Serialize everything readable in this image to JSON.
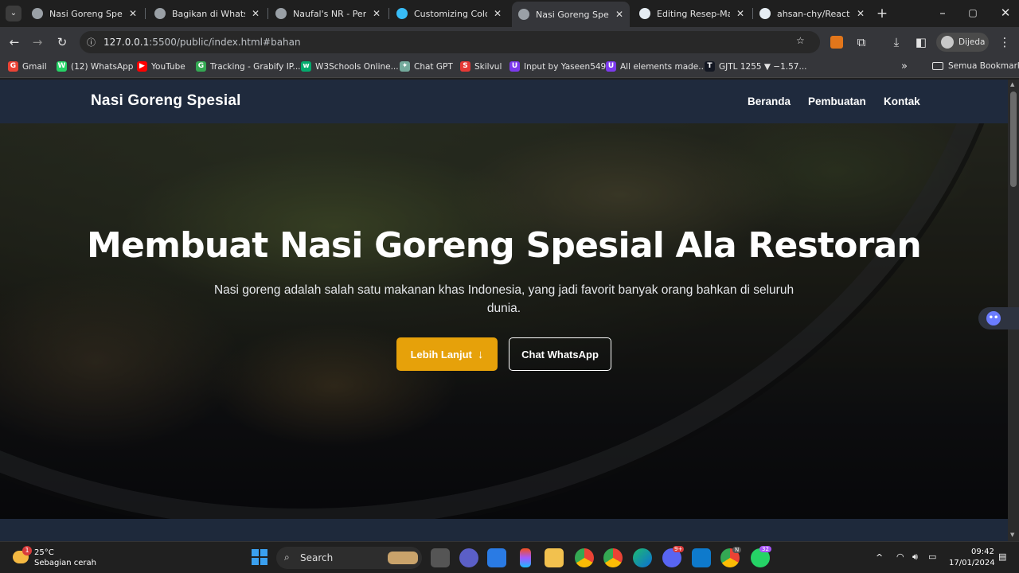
{
  "browser": {
    "tabs": [
      {
        "title": "Nasi Goreng Spesial",
        "active": false,
        "color": "#9aa0a6"
      },
      {
        "title": "Bagikan di WhatsApp",
        "active": false,
        "color": "#9aa0a6"
      },
      {
        "title": "Naufal's NR - Personal",
        "active": false,
        "color": "#9aa0a6"
      },
      {
        "title": "Customizing Colors",
        "active": false,
        "color": "#38bdf8"
      },
      {
        "title": "Nasi Goreng Spesial",
        "active": true,
        "color": "#9aa0a6"
      },
      {
        "title": "Editing Resep-Makan",
        "active": false,
        "color": "#e6edf3"
      },
      {
        "title": "ahsan-chy/React-JS",
        "active": false,
        "color": "#e6edf3"
      }
    ],
    "new_tab": "+",
    "url": {
      "host": "127.0.0.1",
      "rest": ":5500/public/index.html#bahan"
    },
    "profile_label": "Dijeda",
    "bookmarks": [
      {
        "label": "Gmail",
        "icon": "G",
        "color": "#ea4335"
      },
      {
        "label": "(12) WhatsApp",
        "icon": "W",
        "color": "#25d366"
      },
      {
        "label": "YouTube",
        "icon": "▶",
        "color": "#ff0000"
      },
      {
        "label": "Tracking - Grabify IP...",
        "icon": "G",
        "color": "#34a853"
      },
      {
        "label": "W3Schools Online...",
        "icon": "w",
        "color": "#04aa6d"
      },
      {
        "label": "Chat GPT",
        "icon": "✦",
        "color": "#74aa9c"
      },
      {
        "label": "Skilvul",
        "icon": "S",
        "color": "#e53935"
      },
      {
        "label": "Input by Yaseen549",
        "icon": "U",
        "color": "#7c3aed"
      },
      {
        "label": "All elements made...",
        "icon": "U",
        "color": "#7c3aed"
      },
      {
        "label": "GJTL 1255 ▼ −1.57...",
        "icon": "T",
        "color": "#131722"
      }
    ],
    "bookmarks_more": "»",
    "all_bookmarks": "Semua Bookmark"
  },
  "site": {
    "brand": "Nasi Goreng Spesial",
    "nav": [
      "Beranda",
      "Pembuatan",
      "Kontak"
    ],
    "hero": {
      "title": "Membuat Nasi Goreng Spesial Ala Restoran",
      "subtitle": "Nasi goreng adalah salah satu makanan khas Indonesia, yang jadi favorit banyak orang bahkan di seluruh dunia.",
      "primary_button": "Lebih Lanjut",
      "primary_icon": "↓",
      "secondary_button": "Chat WhatsApp"
    }
  },
  "taskbar": {
    "weather_temp": "25°C",
    "weather_desc": "Sebagian cerah",
    "weather_badge": "1",
    "search_placeholder": "Search",
    "discord_badge": "9+",
    "whatsapp_badge": "32",
    "chrome_profile": "N",
    "time": "09:42",
    "date": "17/01/2024"
  },
  "colors": {
    "accent_button": "#e6a10a",
    "navbar": "#1f2a3d"
  }
}
